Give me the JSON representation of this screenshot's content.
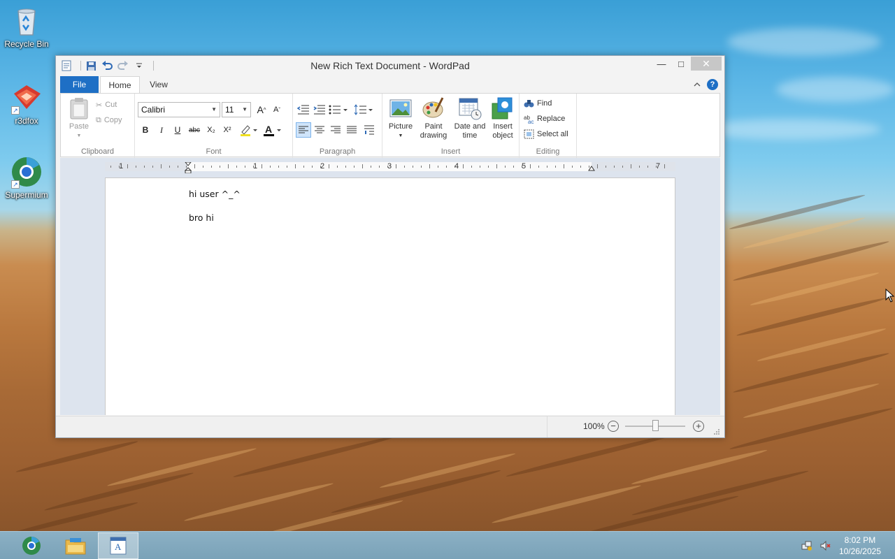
{
  "desktop": {
    "icons": [
      {
        "label": "Recycle Bin",
        "icon": "recycle-bin-icon"
      },
      {
        "label": "r3dfox",
        "icon": "r3dfox-icon"
      },
      {
        "label": "Supermium",
        "icon": "supermium-icon"
      }
    ]
  },
  "window": {
    "title": "New Rich Text Document - WordPad",
    "quick_access": [
      "wordpad-menu-icon",
      "save-icon",
      "undo-icon",
      "redo-icon",
      "customize-qat-icon"
    ],
    "caption": {
      "minimize": "—",
      "maximize": "□",
      "close": "✕"
    }
  },
  "ribbon": {
    "tabs": {
      "file": "File",
      "home": "Home",
      "view": "View"
    },
    "help": "?",
    "clipboard": {
      "label": "Clipboard",
      "paste": "Paste",
      "cut": "Cut",
      "copy": "Copy"
    },
    "font": {
      "label": "Font",
      "family": "Calibri",
      "size": "11",
      "grow": "A",
      "shrink": "A",
      "bold": "B",
      "italic": "I",
      "underline": "U",
      "strike": "abc",
      "subscript": "X₂",
      "superscript": "X²",
      "color_glyph": "A",
      "text_color": "#000000",
      "highlight_color": "#f0e020"
    },
    "paragraph": {
      "label": "Paragraph"
    },
    "insert": {
      "label": "Insert",
      "picture": "Picture",
      "paint_line1": "Paint",
      "paint_line2": "drawing",
      "date_line1": "Date and",
      "date_line2": "time",
      "object_line1": "Insert",
      "object_line2": "object"
    },
    "editing": {
      "label": "Editing",
      "find": "Find",
      "replace": "Replace",
      "select_all": "Select all"
    }
  },
  "ruler": {
    "numbers": [
      "1",
      "1",
      "2",
      "3",
      "4",
      "5",
      "7"
    ]
  },
  "document": {
    "paragraphs": [
      "hi user ^_^",
      "bro hi"
    ]
  },
  "statusbar": {
    "zoom": "100%",
    "zoom_minus": "−",
    "zoom_plus": "+",
    "zoom_level": 1.0
  },
  "taskbar": {
    "items": [
      "supermium-taskbar-icon",
      "file-explorer-icon",
      "wordpad-taskbar-icon"
    ],
    "time": "8:02 PM",
    "date": "10/26/2025"
  },
  "colors": {
    "accent": "#1e6fc5",
    "window_bg": "#f3f3f3",
    "doc_area_bg": "#dde4ee"
  }
}
